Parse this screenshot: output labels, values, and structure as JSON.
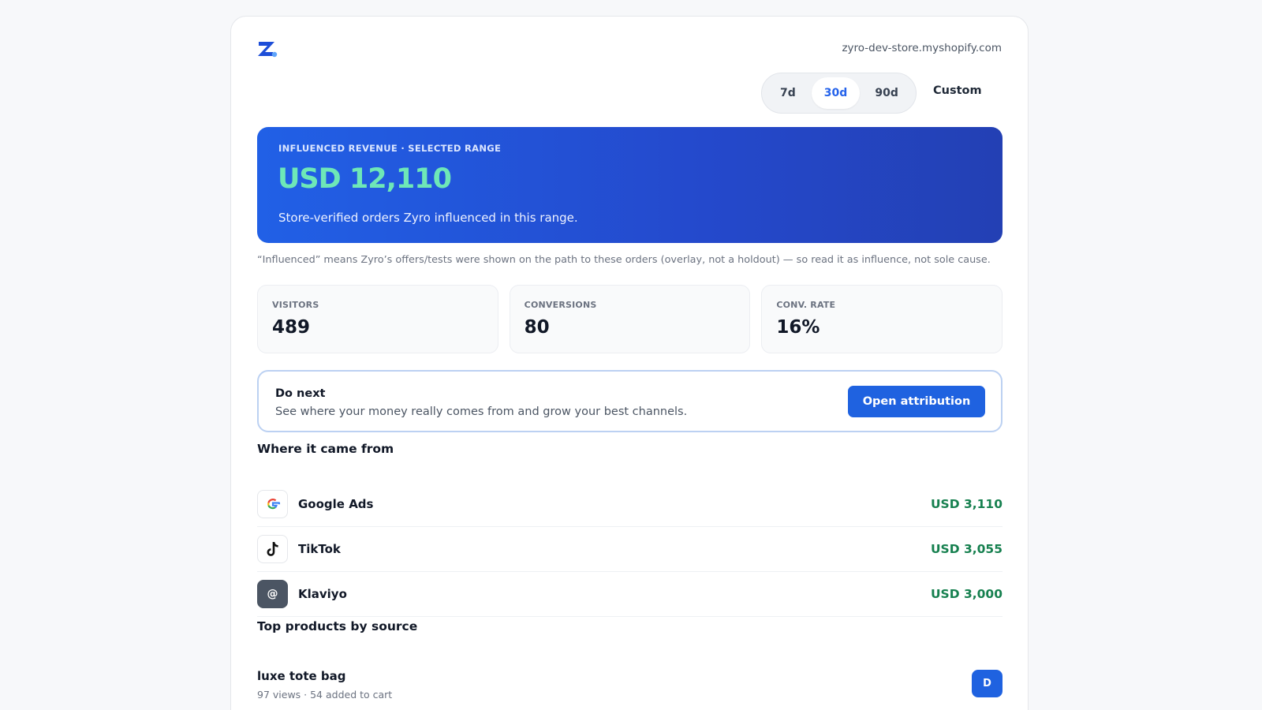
{
  "header": {
    "store_domain": "zyro-dev-store.myshopify.com",
    "brand_color": "#2563eb"
  },
  "range": {
    "options": [
      {
        "label": "7d",
        "active": false
      },
      {
        "label": "30d",
        "active": true
      },
      {
        "label": "90d",
        "active": false
      }
    ],
    "custom_label": "Custom"
  },
  "hero": {
    "label": "INFLUENCED REVENUE · SELECTED RANGE",
    "value": "USD 12,110",
    "subtitle": "Store-verified orders Zyro influenced in this range."
  },
  "note": "“Influenced” means Zyro’s offers/tests were shown on the path to these orders (overlay, not a holdout) — so read it as influence, not sole cause.",
  "stats": [
    {
      "label": "VISITORS",
      "value": "489"
    },
    {
      "label": "CONVERSIONS",
      "value": "80"
    },
    {
      "label": "CONV. RATE",
      "value": "16%"
    }
  ],
  "do_next": {
    "title": "Do next",
    "text": "See where your money really comes from and grow your best channels.",
    "button_label": "Open attribution"
  },
  "sources": {
    "title": "Where it came from",
    "items": [
      {
        "name": "Google Ads",
        "icon": "google-icon",
        "value": "USD 3,110"
      },
      {
        "name": "TikTok",
        "icon": "tiktok-icon",
        "value": "USD 3,055"
      },
      {
        "name": "Klaviyo",
        "icon": "at-sign-icon",
        "value": "USD 3,000"
      }
    ]
  },
  "products": {
    "title": "Top products by source",
    "items": [
      {
        "name": "luxe tote bag",
        "meta": "97 views · 54 added to cart",
        "badge": "D"
      }
    ]
  }
}
